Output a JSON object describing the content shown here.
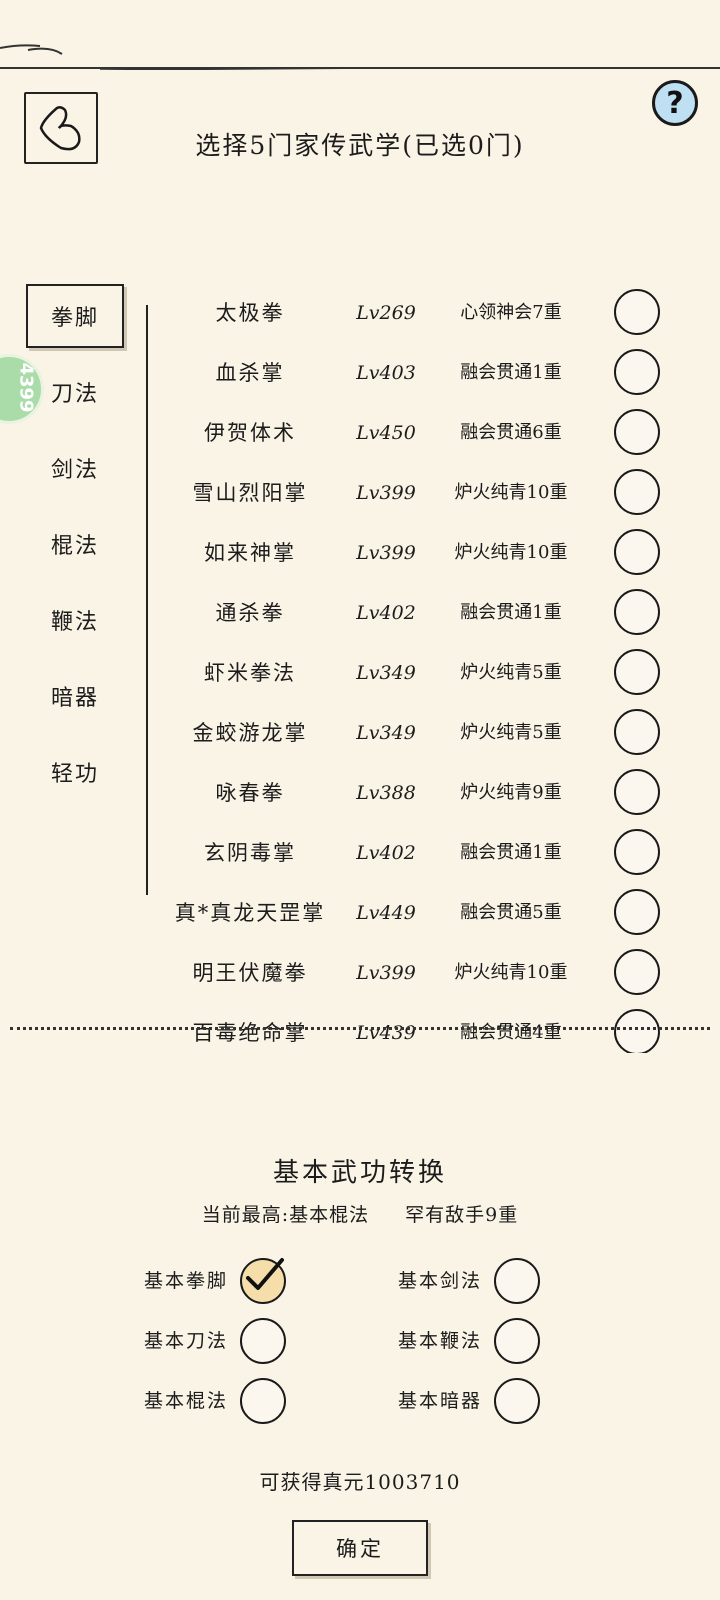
{
  "header": {
    "title": "选择5门家传武学(已选0门)",
    "help_label": "?"
  },
  "side_badge": {
    "text": "4399"
  },
  "tabs": [
    {
      "label": "拳脚",
      "active": true
    },
    {
      "label": "刀法",
      "active": false
    },
    {
      "label": "剑法",
      "active": false
    },
    {
      "label": "棍法",
      "active": false
    },
    {
      "label": "鞭法",
      "active": false
    },
    {
      "label": "暗器",
      "active": false
    },
    {
      "label": "轻功",
      "active": false
    }
  ],
  "skills": [
    {
      "name": "太极拳",
      "level": "Lv269",
      "rank": "心领神会7重"
    },
    {
      "name": "血杀掌",
      "level": "Lv403",
      "rank": "融会贯通1重"
    },
    {
      "name": "伊贺体术",
      "level": "Lv450",
      "rank": "融会贯通6重"
    },
    {
      "name": "雪山烈阳掌",
      "level": "Lv399",
      "rank": "炉火纯青10重"
    },
    {
      "name": "如来神掌",
      "level": "Lv399",
      "rank": "炉火纯青10重"
    },
    {
      "name": "通杀拳",
      "level": "Lv402",
      "rank": "融会贯通1重"
    },
    {
      "name": "虾米拳法",
      "level": "Lv349",
      "rank": "炉火纯青5重"
    },
    {
      "name": "金蛟游龙掌",
      "level": "Lv349",
      "rank": "炉火纯青5重"
    },
    {
      "name": "咏春拳",
      "level": "Lv388",
      "rank": "炉火纯青9重"
    },
    {
      "name": "玄阴毒掌",
      "level": "Lv402",
      "rank": "融会贯通1重"
    },
    {
      "name": "真*真龙天罡掌",
      "level": "Lv449",
      "rank": "融会贯通5重"
    },
    {
      "name": "明王伏魔拳",
      "level": "Lv399",
      "rank": "炉火纯青10重"
    },
    {
      "name": "百毒绝命掌",
      "level": "Lv439",
      "rank": "融会贯通4重"
    }
  ],
  "conversion": {
    "title": "基本武功转换",
    "current_label": "当前最高:基本棍法",
    "current_rank": "罕有敌手9重",
    "options": [
      {
        "label": "基本拳脚",
        "checked": true
      },
      {
        "label": "基本剑法",
        "checked": false
      },
      {
        "label": "基本刀法",
        "checked": false
      },
      {
        "label": "基本鞭法",
        "checked": false
      },
      {
        "label": "基本棍法",
        "checked": false
      },
      {
        "label": "基本暗器",
        "checked": false
      }
    ],
    "reward": "可获得真元1003710",
    "confirm_label": "确定"
  }
}
